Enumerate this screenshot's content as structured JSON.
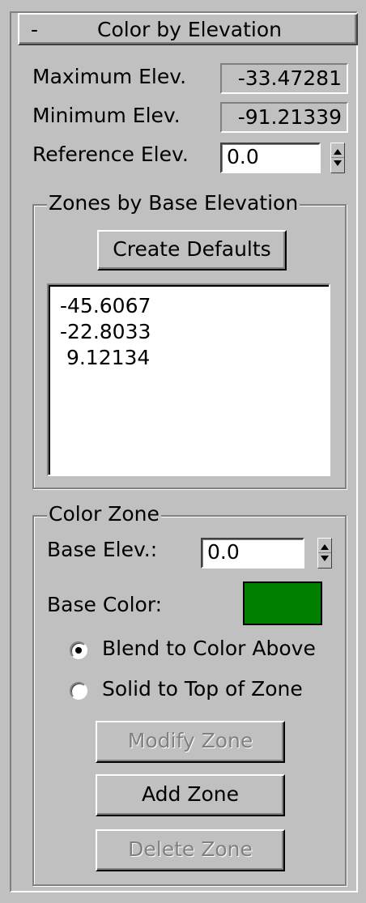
{
  "rollout": {
    "collapse_symbol": "-",
    "title": "Color by Elevation"
  },
  "elevation": {
    "max_label": "Maximum Elev.",
    "max_value": "-33.47281",
    "min_label": "Minimum Elev.",
    "min_value": "-91.21339",
    "ref_label": "Reference Elev.",
    "ref_value": "0.0"
  },
  "zones_group": {
    "title": "Zones by Base Elevation",
    "create_defaults_label": "Create Defaults",
    "zones": [
      "-45.6067",
      "-22.8033",
      " 9.12134"
    ]
  },
  "color_zone_group": {
    "title": "Color Zone",
    "base_elev_label": "Base Elev.:",
    "base_elev_value": "0.0",
    "base_color_label": "Base Color:",
    "base_color": "#008000",
    "blend_label": "Blend to Color Above",
    "solid_label": "Solid to Top of Zone",
    "selected_mode": "blend",
    "modify_label": "Modify Zone",
    "add_label": "Add Zone",
    "delete_label": "Delete Zone"
  }
}
